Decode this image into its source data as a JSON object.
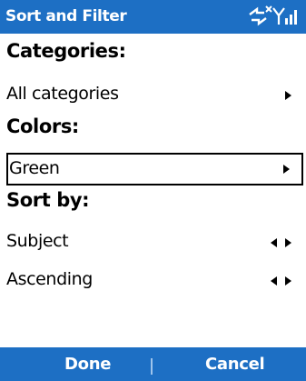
{
  "titlebar": {
    "title": "Sort and Filter",
    "icons": [
      "connectivity-icon",
      "signal-strength-icon"
    ]
  },
  "sections": {
    "categories": {
      "header": "Categories:",
      "value": "All categories"
    },
    "colors": {
      "header": "Colors:",
      "value": "Green"
    },
    "sort_by": {
      "header": "Sort by:",
      "field": "Subject",
      "order": "Ascending"
    }
  },
  "softkeys": {
    "left": "Done",
    "right": "Cancel"
  },
  "colors": {
    "bar_background": "#1d6fc4",
    "bar_text": "#ffffff",
    "text": "#000000"
  }
}
